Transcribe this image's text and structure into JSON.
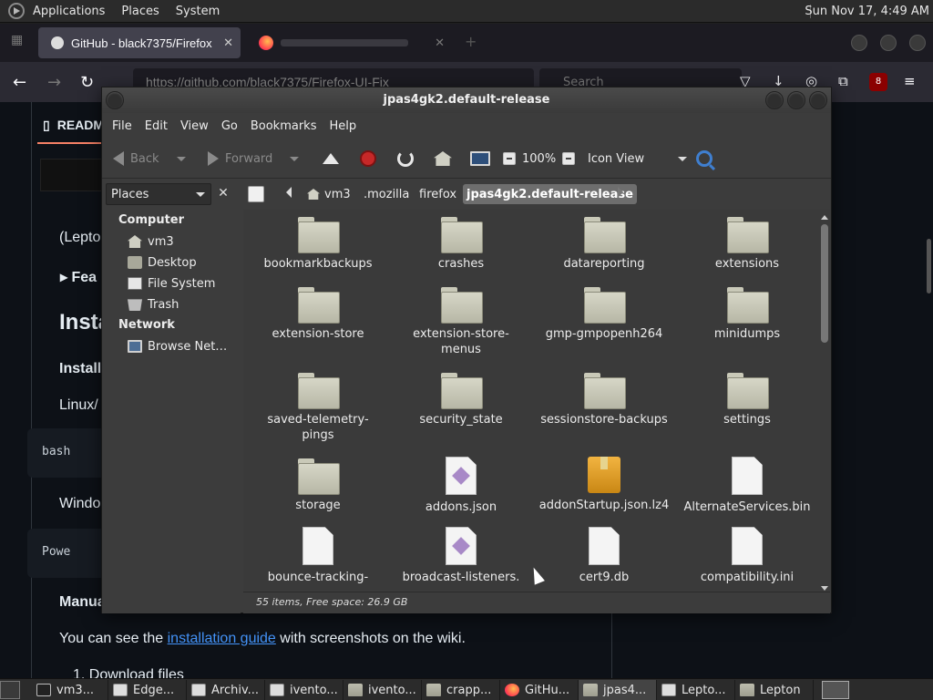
{
  "top_panel": {
    "menus": [
      "Applications",
      "Places",
      "System"
    ],
    "clock": "Sun Nov 17,  4:49 AM"
  },
  "firefox": {
    "tab_active": "GitHub - black7375/Firefox",
    "url": "https://github.com/black7375/Firefox-UI-Fix",
    "search_placeholder": "Search",
    "extension_badge": "8",
    "readme_tab": "README"
  },
  "github_page": {
    "partial_texts": {
      "lepto": "(Lepto",
      "feat": "Fea",
      "insta_heading": "Insta",
      "install_bold": "Install",
      "linux": "Linux/",
      "bash": "bash",
      "windows": "Windo",
      "powershell": "Powe",
      "manual": "Manua"
    },
    "guide_prefix": "You can see the ",
    "guide_link": "installation guide",
    "guide_suffix": " with screenshots on the wiki.",
    "list_item": "1. Download files"
  },
  "caja": {
    "title": "jpas4gk2.default-release",
    "menubar": [
      "File",
      "Edit",
      "View",
      "Go",
      "Bookmarks",
      "Help"
    ],
    "toolbar": {
      "back": "Back",
      "forward": "Forward",
      "zoom": "100%",
      "view_mode": "Icon View"
    },
    "places_combo": "Places",
    "breadcrumbs": [
      "vm3",
      ".mozilla",
      "firefox",
      "jpas4gk2.default-release"
    ],
    "sidebar": {
      "computer_heading": "Computer",
      "computer_items": [
        "vm3",
        "Desktop",
        "File System",
        "Trash"
      ],
      "network_heading": "Network",
      "network_items": [
        "Browse Net…"
      ]
    },
    "files": [
      {
        "name": "bookmarkbackups",
        "type": "folder"
      },
      {
        "name": "crashes",
        "type": "folder"
      },
      {
        "name": "datareporting",
        "type": "folder"
      },
      {
        "name": "extensions",
        "type": "folder"
      },
      {
        "name": "extension-store",
        "type": "folder"
      },
      {
        "name": "extension-store-menus",
        "type": "folder"
      },
      {
        "name": "gmp-gmpopenh264",
        "type": "folder"
      },
      {
        "name": "minidumps",
        "type": "folder"
      },
      {
        "name": "saved-telemetry-pings",
        "type": "folder"
      },
      {
        "name": "security_state",
        "type": "folder"
      },
      {
        "name": "sessionstore-backups",
        "type": "folder"
      },
      {
        "name": "settings",
        "type": "folder"
      },
      {
        "name": "storage",
        "type": "folder"
      },
      {
        "name": "addons.json",
        "type": "json"
      },
      {
        "name": "addonStartup.json.lz4",
        "type": "package"
      },
      {
        "name": "AlternateServices.bin",
        "type": "file"
      },
      {
        "name": "bounce-tracking-",
        "type": "file"
      },
      {
        "name": "broadcast-listeners.",
        "type": "json"
      },
      {
        "name": "cert9.db",
        "type": "file"
      },
      {
        "name": "compatibility.ini",
        "type": "file"
      }
    ],
    "status": "55 items, Free space: 26.9 GB"
  },
  "taskbar": {
    "items": [
      "vm3...",
      "Edge...",
      "Archiv...",
      "ivento...",
      "ivento...",
      "crapp...",
      "GitHu...",
      "jpas4...",
      "Lepto...",
      "Lepton"
    ]
  }
}
